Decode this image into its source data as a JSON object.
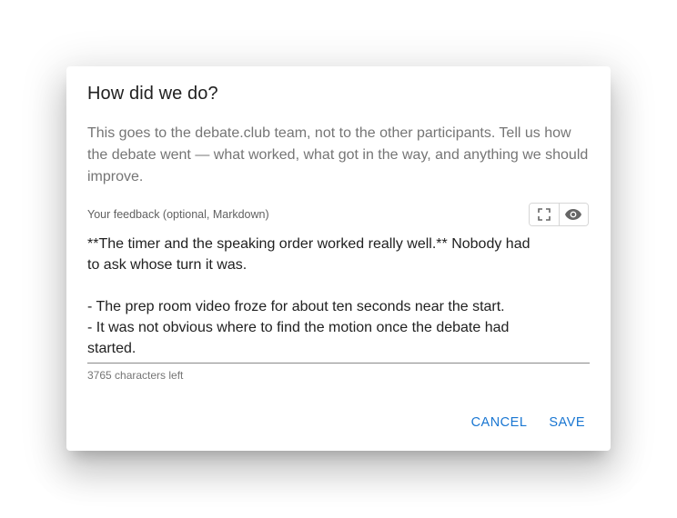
{
  "dialog": {
    "title": "How did we do?",
    "description": "This goes to the debate.club team, not to the other participants. Tell us how the debate went — what worked, what got in the way, and anything we should improve.",
    "field_label": "Your feedback (optional, Markdown)",
    "toolbar": {
      "fullscreen_icon": "fullscreen-icon",
      "preview_icon": "eye-icon"
    },
    "feedback_lines": [
      "**The timer and the speaking order worked really well.** Nobody had",
      "to ask whose turn it was.",
      "",
      "- The prep room video froze for about ten seconds near the start.",
      "- It was not obvious where to find the motion once the debate had",
      "started."
    ],
    "helper_text": "3765 characters left",
    "cancel_label": "CANCEL",
    "save_label": "SAVE"
  },
  "colors": {
    "accent": "#1976d2",
    "title_text": "#212121",
    "secondary_text": "#757575"
  }
}
